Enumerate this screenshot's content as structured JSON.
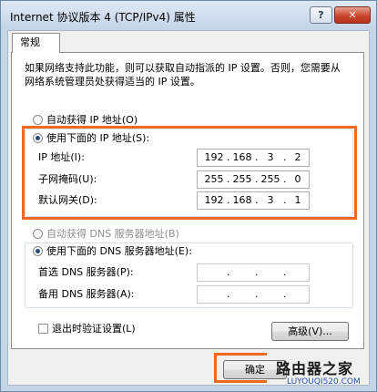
{
  "window": {
    "title": "Internet 协议版本 4 (TCP/IPv4) 属性",
    "help_label": "?",
    "close_label": "✕"
  },
  "tabs": [
    {
      "label": "常规"
    }
  ],
  "description": "如果网络支持此功能，则可以获取自动指派的 IP 设置。否则，您需要从网络系统管理员处获得适当的 IP 设置。",
  "ip_section": {
    "auto_label": "自动获得 IP 地址(O)",
    "manual_label": "使用下面的 IP 地址(S):",
    "selected": "manual",
    "fields": [
      {
        "label": "IP 地址(I):",
        "octets": [
          "192",
          "168",
          "3",
          "2"
        ]
      },
      {
        "label": "子网掩码(U):",
        "octets": [
          "255",
          "255",
          "255",
          "0"
        ]
      },
      {
        "label": "默认网关(D):",
        "octets": [
          "192",
          "168",
          "3",
          "1"
        ]
      }
    ]
  },
  "dns_section": {
    "auto_label": "自动获得 DNS 服务器地址(B)",
    "manual_label": "使用下面的 DNS 服务器地址(E):",
    "selected": "manual",
    "fields": [
      {
        "label": "首选 DNS 服务器(P):",
        "octets": [
          "",
          "",
          "",
          ""
        ]
      },
      {
        "label": "备用 DNS 服务器(A):",
        "octets": [
          "",
          "",
          "",
          ""
        ]
      }
    ]
  },
  "validate_on_exit_label": "退出时验证设置(L)",
  "advanced_button_label": "高级(V)...",
  "ok_button_label": "确定",
  "watermark": {
    "line1": "路由器之家",
    "line2": "LUYOUQI520.COM"
  },
  "colors": {
    "highlight": "#ee6a1f",
    "radio_selected": "#2a4a78"
  }
}
